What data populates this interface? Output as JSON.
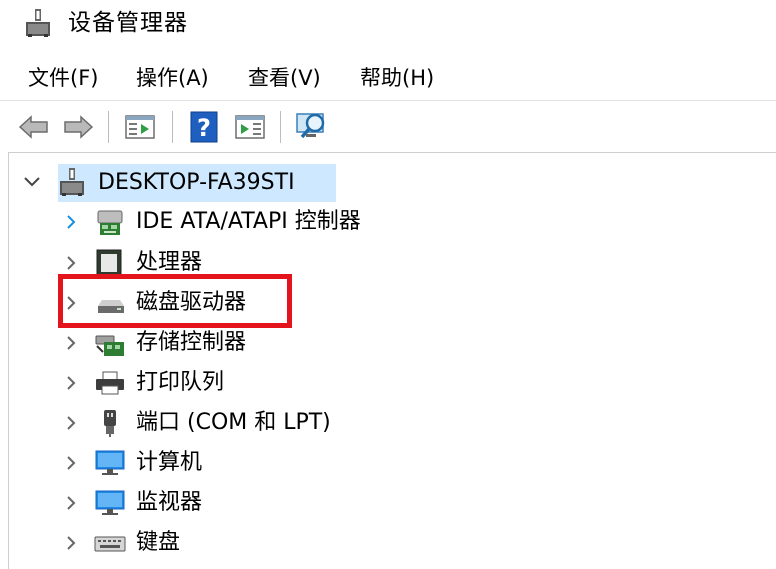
{
  "window": {
    "title": "设备管理器"
  },
  "menu": [
    {
      "label": "文件(F)"
    },
    {
      "label": "操作(A)"
    },
    {
      "label": "查看(V)"
    },
    {
      "label": "帮助(H)"
    }
  ],
  "toolbar": {
    "buttons": [
      "back-icon",
      "forward-icon",
      "properties-icon",
      "help-icon",
      "update-driver-icon",
      "scan-hardware-icon"
    ]
  },
  "tree": {
    "root": {
      "label": "DESKTOP-FA39STI",
      "expanded": true
    },
    "items": [
      {
        "label": "IDE ATA/ATAPI 控制器",
        "icon": "ide-controller-icon"
      },
      {
        "label": "处理器",
        "icon": "processor-icon"
      },
      {
        "label": "磁盘驱动器",
        "icon": "disk-drive-icon"
      },
      {
        "label": "存储控制器",
        "icon": "storage-controller-icon"
      },
      {
        "label": "打印队列",
        "icon": "printer-icon"
      },
      {
        "label": "端口 (COM 和 LPT)",
        "icon": "port-icon"
      },
      {
        "label": "计算机",
        "icon": "computer-icon"
      },
      {
        "label": "监视器",
        "icon": "monitor-icon"
      },
      {
        "label": "键盘",
        "icon": "keyboard-icon"
      }
    ]
  },
  "colors": {
    "selection": "#cde8ff",
    "highlight_box": "#e3141b",
    "chevron_active": "#1a8fe0"
  }
}
